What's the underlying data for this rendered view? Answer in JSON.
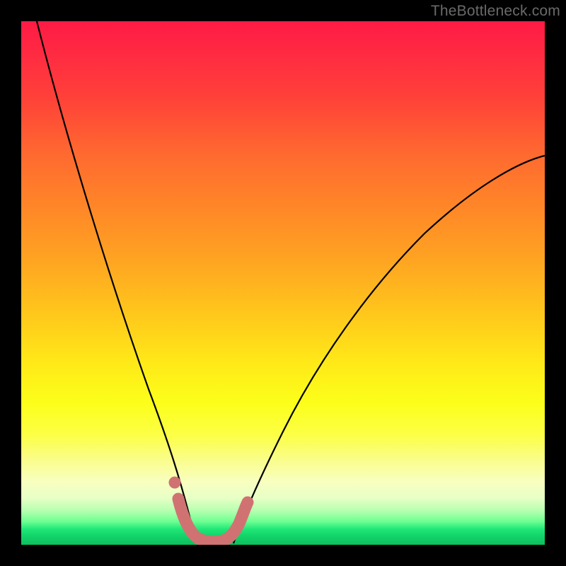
{
  "watermark": "TheBottleneck.com",
  "chart_data": {
    "type": "line",
    "title": "",
    "xlabel": "",
    "ylabel": "",
    "xlim": [
      0,
      100
    ],
    "ylim": [
      0,
      100
    ],
    "series": [
      {
        "name": "left-curve",
        "x": [
          3,
          6,
          10,
          14,
          18,
          22,
          25,
          27,
          29,
          30.5,
          32,
          33
        ],
        "y": [
          100,
          84,
          66,
          51,
          38,
          27,
          18,
          12,
          7,
          4,
          1.5,
          0.5
        ]
      },
      {
        "name": "right-curve",
        "x": [
          41,
          43,
          46,
          50,
          55,
          62,
          70,
          80,
          90,
          100
        ],
        "y": [
          0.5,
          4,
          10,
          18,
          28,
          40,
          51,
          61,
          68,
          74
        ]
      },
      {
        "name": "salmon-marker-path",
        "x": [
          30,
          31,
          32,
          33,
          34.5,
          36,
          37.5,
          39,
          40.5,
          41.5,
          42.5,
          43.2
        ],
        "y": [
          8.5,
          5.5,
          3,
          1.5,
          0.8,
          0.7,
          0.8,
          1.3,
          2.5,
          4,
          6,
          8
        ]
      },
      {
        "name": "salmon-isolated-dot",
        "x": [
          29.3
        ],
        "y": [
          12
        ]
      }
    ],
    "colors": {
      "curve": "#000000",
      "marker": "#d17272",
      "gradient_top": "#ff1a45",
      "gradient_mid": "#ffe818",
      "gradient_bottom": "#0dbf5e"
    }
  }
}
